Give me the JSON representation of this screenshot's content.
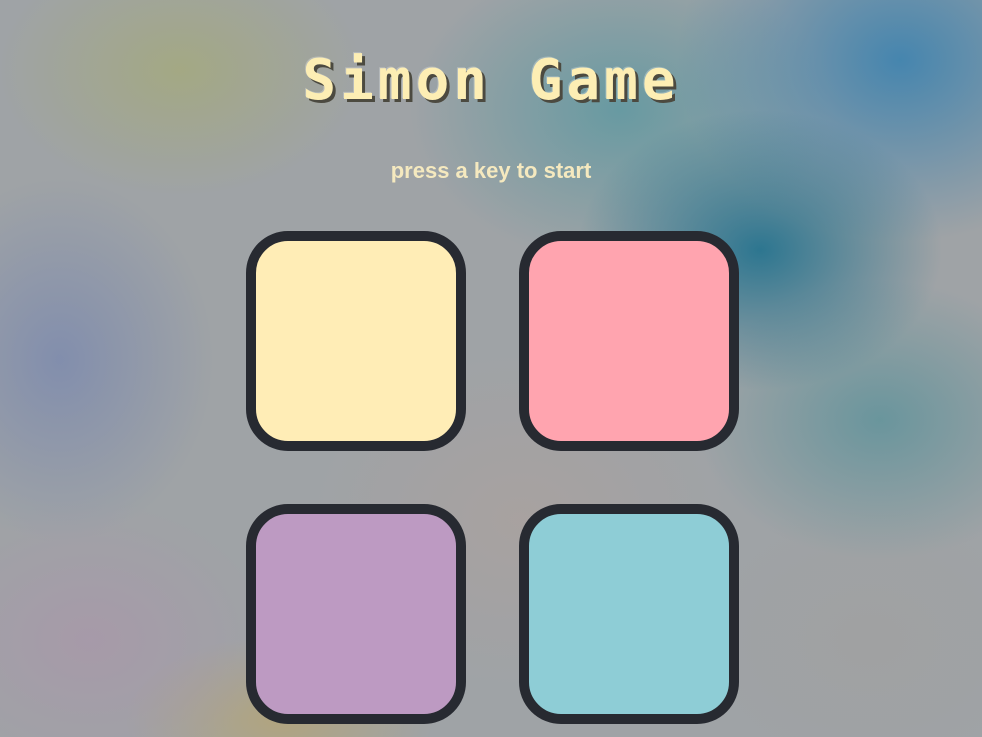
{
  "game": {
    "title": "Simon Game",
    "status_text": "press a key to start"
  },
  "pads": [
    {
      "id": "yellow",
      "color": "#ffedb6"
    },
    {
      "id": "pink",
      "color": "#ffa4af"
    },
    {
      "id": "purple",
      "color": "#bd9ac2"
    },
    {
      "id": "blue",
      "color": "#8ecdd6"
    }
  ],
  "theme": {
    "title_color": "#fdeeb4",
    "status_color": "#f5e9bf",
    "pad_border_color": "#272a31"
  }
}
